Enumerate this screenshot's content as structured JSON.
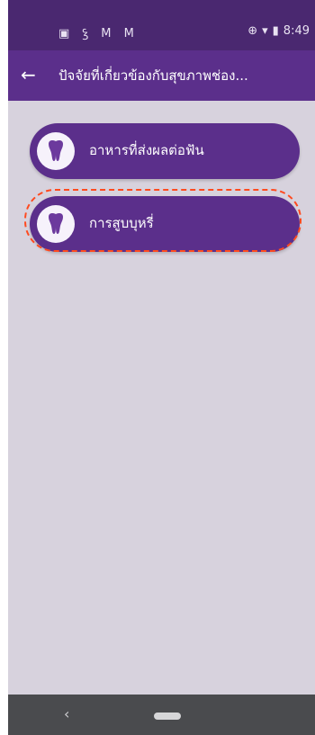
{
  "status": {
    "left_icons": [
      "sim-card-icon",
      "assistant-icon",
      "gmail-icon",
      "gmail-icon"
    ],
    "time": "8:49"
  },
  "appbar": {
    "back_icon": "arrow-left-icon",
    "title": "ปัจจัยที่เกี่ยวข้องกับสุขภาพช่อง..."
  },
  "menu": {
    "items": [
      {
        "label": "อาหารที่ส่งผลต่อฟัน",
        "icon": "tooth-icon"
      },
      {
        "label": "การสูบบุหรี่",
        "icon": "tooth-icon",
        "highlighted": true
      }
    ]
  },
  "colors": {
    "accent": "#5b2f8b",
    "status_bar": "#4a2870",
    "background": "#d7d2dd",
    "highlight": "#ff4a1f"
  }
}
